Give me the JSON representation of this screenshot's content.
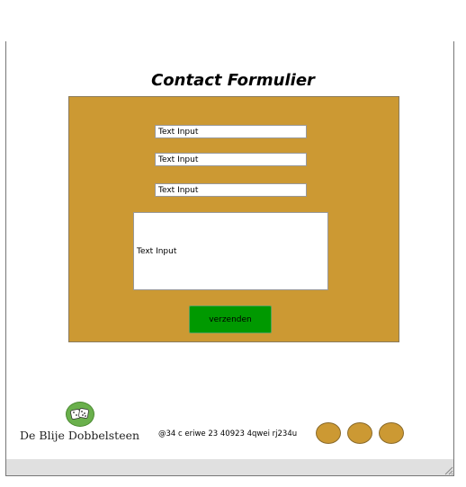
{
  "page": {
    "title": "Contact Formulier"
  },
  "form": {
    "field1_label": "Text Input",
    "field2_label": "Text Input",
    "field3_label": "Text Input",
    "message_label": "Text Input",
    "submit_label": "verzenden"
  },
  "footer": {
    "brand_name": "De Blije Dobbelsteen",
    "address": "@34 c eriwe 23 40923 4qwei rj234u",
    "social_icons": [
      "social-icon-1",
      "social-icon-2",
      "social-icon-3"
    ]
  },
  "colors": {
    "panel": "#cc9933",
    "button": "#009900",
    "logo": "#6ab04c"
  }
}
